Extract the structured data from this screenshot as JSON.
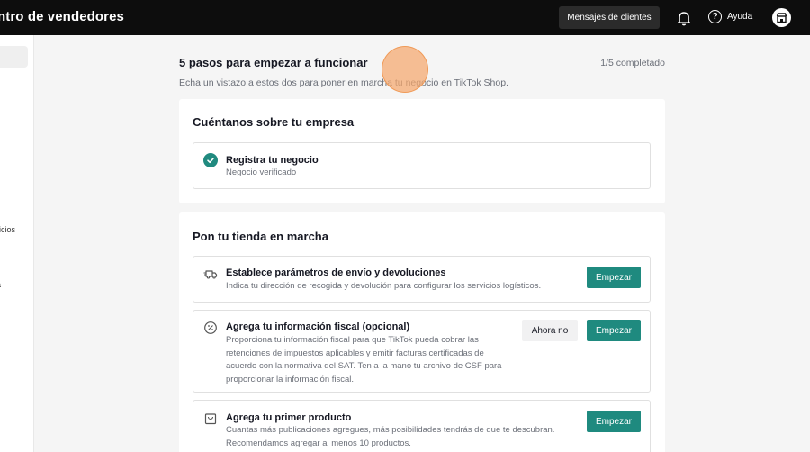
{
  "topbar": {
    "title": "ntro de vendedores",
    "messages_button": "Mensajes de clientes",
    "help_label": "Ayuda"
  },
  "sidebar": {
    "fragment_1": "icios",
    "fragment_2": "a"
  },
  "header": {
    "title": "5 pasos para empezar a funcionar",
    "progress": "1/5 completado",
    "subtitle": "Echa un vistazo a estos dos para poner en marcha tu negocio en TikTok Shop."
  },
  "section_business": {
    "title": "Cuéntanos sobre tu empresa",
    "task": {
      "title": "Registra tu negocio",
      "status": "Negocio verificado"
    }
  },
  "section_store": {
    "title": "Pon tu tienda en marcha",
    "tasks": [
      {
        "title": "Establece parámetros de envío y devoluciones",
        "description": "Indica tu dirección de recogida y devolución para configurar los servicios logísticos.",
        "primary_label": "Empezar"
      },
      {
        "title": "Agrega tu información fiscal (opcional)",
        "description_lines": [
          "Proporciona tu información fiscal para que TikTok pueda cobrar las",
          "retenciones de impuestos aplicables y emitir facturas certificadas de",
          "acuerdo con la normativa del SAT. Ten a la mano tu archivo de CSF para",
          "proporcionar la información fiscal."
        ],
        "secondary_label": "Ahora no",
        "primary_label": "Empezar"
      },
      {
        "title": "Agrega tu primer producto",
        "description_lines": [
          "Cuantas más publicaciones agregues, más posibilidades tendrás de que te descubran.",
          "Recomendamos agregar al menos 10 productos."
        ],
        "primary_label": "Empezar"
      }
    ]
  },
  "colors": {
    "accent": "#1f8a7f",
    "topbar": "#0d0d0d",
    "cursor_highlight": "#f5a86e"
  }
}
